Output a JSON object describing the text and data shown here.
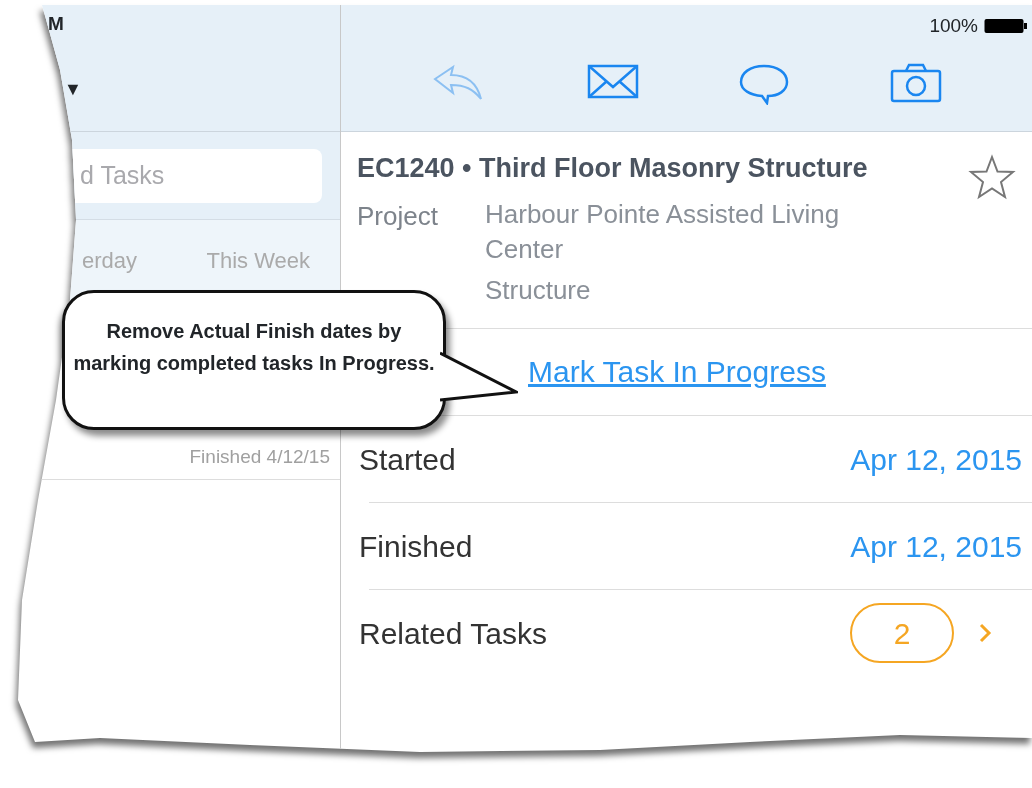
{
  "status_bar": {
    "time": "M",
    "battery": "100%"
  },
  "left_pane": {
    "filter_caret": "▼",
    "search": {
      "placeholder": "d Tasks"
    },
    "segments": [
      "erday",
      "This Week"
    ],
    "task_status": "Finished 4/12/15"
  },
  "task": {
    "title": "EC1240 • Third Floor Masonry Structure",
    "starred": false,
    "details": [
      {
        "label": "Project",
        "values": [
          "Harbour Pointe Assisted Living Center",
          "Structure"
        ]
      }
    ],
    "action": "Mark Task In Progress",
    "rows": [
      {
        "label": "Started",
        "value": "Apr 12, 2015",
        "kind": "date"
      },
      {
        "label": "Finished",
        "value": "Apr 12, 2015",
        "kind": "date"
      },
      {
        "label": "Related Tasks",
        "value": "2",
        "kind": "count"
      }
    ]
  },
  "callout": {
    "text": "Remove Actual Finish dates by marking completed tasks In Progress."
  }
}
